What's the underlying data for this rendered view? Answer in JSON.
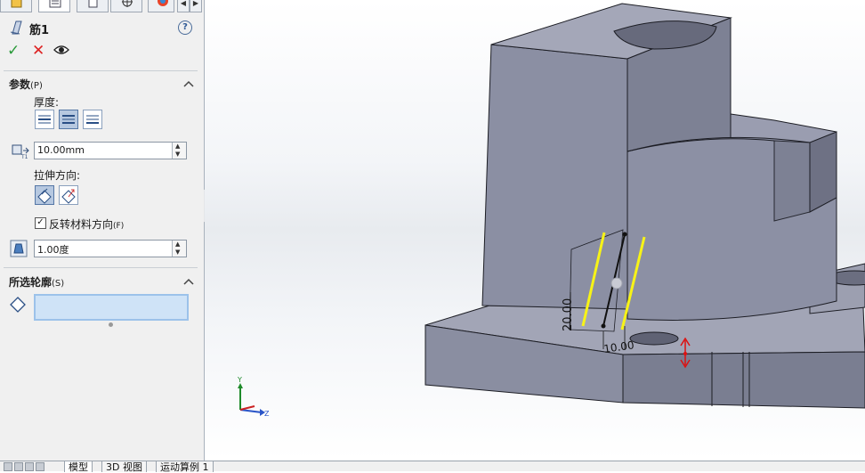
{
  "feature": {
    "title": "筋1"
  },
  "actions": {
    "ok": "✓",
    "cancel": "✕"
  },
  "params": {
    "title": "参数",
    "title_accel": "(P)",
    "thickness_label": "厚度:",
    "thickness_value": "10.00mm",
    "extrude_dir_label": "拉伸方向:",
    "flip_label": "反转材料方向",
    "flip_accel": "(F)",
    "flip_checked": true,
    "draft_value": "1.00度"
  },
  "profiles": {
    "title": "所选轮廓",
    "title_accel": "(S)"
  },
  "help": "?",
  "sketch": {
    "dim_vertical": "20.00",
    "dim_horizontal": "10.00"
  },
  "triad": {
    "y": "Y",
    "z": "Z"
  },
  "bottom_tabs": [
    "模型",
    "3D 视图",
    "运动算例 1"
  ],
  "colors": {
    "body": "#8b8fa3",
    "body_top": "#a4a7b8",
    "highlight": "#f7f317"
  }
}
